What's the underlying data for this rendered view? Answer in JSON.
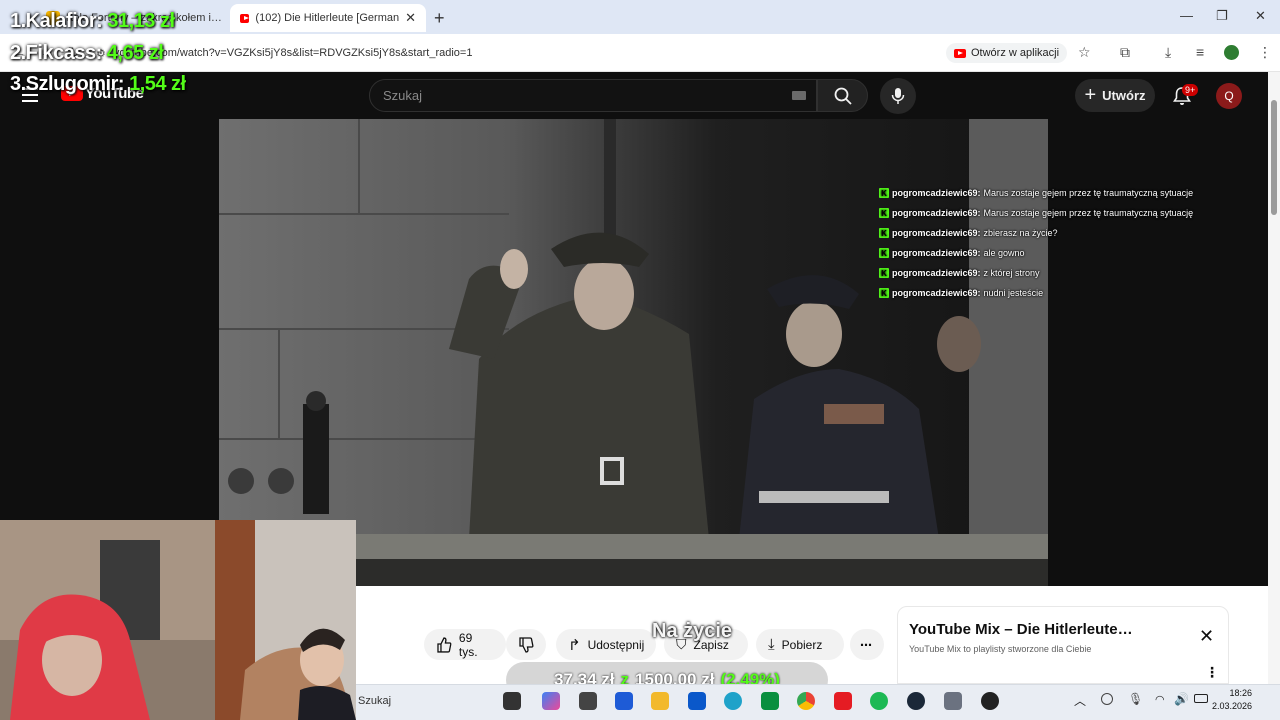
{
  "browser": {
    "tabs": [
      {
        "label": "Koło Fortuny – zakręć kołem i…",
        "active": false
      },
      {
        "label": "(102) Die Hitlerleute [German ×",
        "active": false
      },
      {
        "label": "",
        "active": false
      }
    ],
    "active_tab_label": "(102) Die Hitlerleute [German",
    "url": "youtube.com/watch?v=VGZKsi5jY8s&list=RDVGZKsi5jY8s&start_radio=1",
    "open_in_app_label": "Otwórz w aplikacji"
  },
  "stream_overlay": {
    "ranking": [
      {
        "label": "1.Kalafior:",
        "amount": "31,13 zł"
      },
      {
        "label": "2.Fikcass:",
        "amount": "4,65 zł"
      },
      {
        "label": "3.Szlugomir:",
        "amount": "1,54 zł"
      }
    ],
    "caption": "Na życie",
    "donation": {
      "current": "37,34 zł",
      "sep": "z",
      "goal": "1500,00 zł",
      "percent": "(2.49%)"
    }
  },
  "youtube": {
    "logo_text": "YouTube",
    "search_placeholder": "Szukaj",
    "create_label": "Utwórz",
    "notifications_badge": "9+",
    "avatar_letter": "Q",
    "actions": {
      "likes": "69 tys.",
      "share": "Udostępnij",
      "save": "Zapisz",
      "download": "Pobierz",
      "more": "⋯"
    },
    "mix": {
      "title": "YouTube Mix – Die Hitlerleute…",
      "subtitle": "YouTube Mix to playlisty stworzone dla Ciebie"
    }
  },
  "chat": [
    {
      "user": "pogromcadziewic69:",
      "text": "Marus zostaje gejem przez tę traumatyczną sytuacje"
    },
    {
      "user": "pogromcadziewic69:",
      "text": "Marus zostaje gejem przez tę traumatyczną sytuację"
    },
    {
      "user": "pogromcadziewic69:",
      "text": "zbierasz na życie?"
    },
    {
      "user": "pogromcadziewic69:",
      "text": "ale gowno"
    },
    {
      "user": "pogromcadziewic69:",
      "text": "z której strony"
    },
    {
      "user": "pogromcadziewic69:",
      "text": "nudni jesteście"
    }
  ],
  "taskbar": {
    "search_label": "Szukaj",
    "time": "18:26",
    "date": "2.03.2026"
  },
  "colors": {
    "kick_green": "#53fc18",
    "yt_red": "#ff0000",
    "yt_dark": "#0f0f0f"
  }
}
